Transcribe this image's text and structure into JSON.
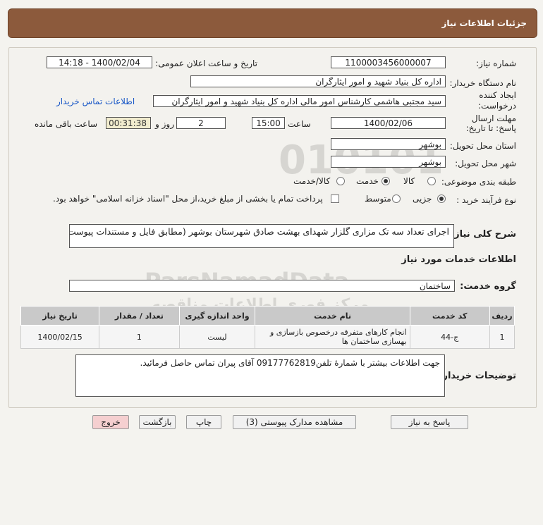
{
  "header": {
    "title": "جزئیات اطلاعات نیاز"
  },
  "fields": {
    "need_number_label": "شماره نیاز:",
    "need_number": "1100003456000007",
    "announce_label": "تاریخ و ساعت اعلان عمومی:",
    "announce_value": "1400/02/04 - 14:18",
    "buyer_org_label": "نام دستگاه خریدار:",
    "buyer_org": "اداره کل بنیاد شهید و امور ایثارگران",
    "creator_label": "ایجاد کننده درخواست:",
    "creator": "سید مجتبی هاشمی کارشناس امور مالی اداره کل بنیاد شهید و امور ایثارگران",
    "contact_link": "اطلاعات تماس خریدار",
    "deadline_label": "مهلت ارسال پاسخ: تا تاریخ:",
    "deadline_date": "1400/02/06",
    "time_label": "ساعت",
    "deadline_time": "15:00",
    "days_label": "روز و",
    "days": "2",
    "remaining": "00:31:38",
    "remaining_label": "ساعت باقی مانده",
    "province_label": "استان محل تحویل:",
    "province": "بوشهر",
    "city_label": "شهر محل تحویل:",
    "city": "بوشهر",
    "category_label": "طبقه بندی موضوعی:",
    "category_options": [
      "کالا",
      "خدمت",
      "کالا/خدمت"
    ],
    "category_selected": "خدمت",
    "process_label": "نوع فرآیند خرید :",
    "process_options": [
      "جزیی",
      "متوسط"
    ],
    "process_selected": "جزیی",
    "payment_note": "پرداخت تمام یا بخشی از مبلغ خرید،از محل \"اسناد خزانه اسلامی\" خواهد بود."
  },
  "description": {
    "label": "شرح کلی نیاز:",
    "text": "اجرای تعداد سه تک مزاری گلزار شهدای بهشت صادق  شهرستان بوشهر (مطابق فایل و مستندات پیوست)"
  },
  "services": {
    "section_title": "اطلاعات خدمات مورد نیاز",
    "group_label": "گروه خدمت:",
    "group_value": "ساختمان",
    "columns": [
      "ردیف",
      "کد خدمت",
      "نام خدمت",
      "واحد اندازه گیری",
      "تعداد / مقدار",
      "تاریخ نیاز"
    ],
    "rows": [
      {
        "row": "1",
        "code": "ج-44",
        "name": "انجام کارهای متفرقه درخصوص بازسازی و بهسازی ساختمان ها",
        "unit": "لیست",
        "qty": "1",
        "date": "1400/02/15"
      }
    ]
  },
  "buyer_notes": {
    "label": "توضیحات خریدار:",
    "text": "جهت اطلاعات بیشتر با شمارۀ تلفن09177762819 آقای پیران تماس حاصل فرمائید."
  },
  "buttons": {
    "reply": "پاسخ به نیاز",
    "attachments": "مشاهده مدارک پیوستی (3)",
    "print": "چاپ",
    "back": "بازگشت",
    "exit": "خروج"
  },
  "watermark": {
    "digits": "010101",
    "brand": "ParsNamadData",
    "line1": "مرکز فوری اطلاعات مناقصه",
    "line2": "پایگاه اطلاع رسانی مناقصه و مزایده",
    "phone": "۰۲۱-۸۸۳۴۹۶۷۰-۵"
  },
  "colors": {
    "title_bar": "#8c5a3c",
    "link": "#1a58c7",
    "exit_button": "#f5cfd0",
    "timer_bg": "#f2edcf"
  }
}
